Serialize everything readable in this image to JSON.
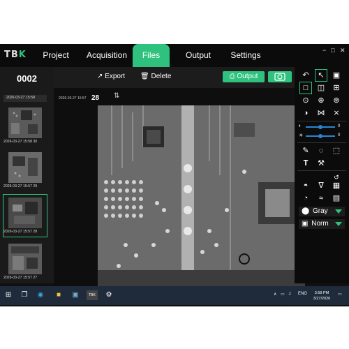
{
  "app": {
    "logo_a": "TB",
    "logo_b": "K"
  },
  "nav": {
    "items": [
      "Project",
      "Acquisition",
      "Files",
      "Output",
      "Settings"
    ],
    "active": "Files"
  },
  "window_controls": {
    "minimize": "−",
    "maximize": "□",
    "close": "✕"
  },
  "left_panel": {
    "file_id": "0002",
    "thumbnails": [
      {
        "label": "2026-03-27 15:58"
      },
      {
        "label": "2026-03-27 15:58 30"
      },
      {
        "label": "2026-03-27 15:57 29"
      },
      {
        "label": "2026-03-27 15:57 28"
      },
      {
        "label": "2026-03-27 15:57 27"
      }
    ]
  },
  "toolbar": {
    "export_label": "Export",
    "delete_label": "Delete",
    "output_label": "Output"
  },
  "viewer": {
    "timestamp": "2026-03-27 15:57",
    "count": "28"
  },
  "right_panel": {
    "slider1_value": "0",
    "slider2_value": "0",
    "colormap_label": "Gray",
    "mode_label": "Norm",
    "accent": "#2ec27e",
    "slider_color": "#2a84d4"
  },
  "taskbar": {
    "lang": "ENG",
    "time": "3:59 PM",
    "date": "3/27/2026"
  }
}
